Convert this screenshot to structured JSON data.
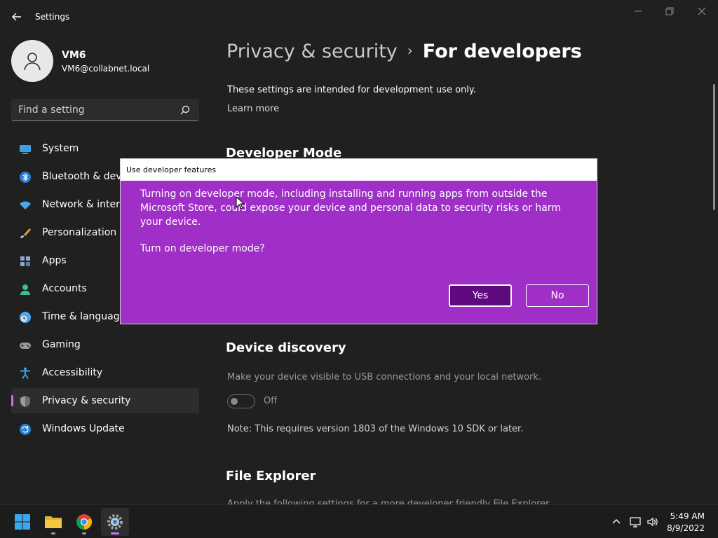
{
  "window": {
    "app_title": "Settings"
  },
  "user": {
    "name": "VM6",
    "email": "VM6@collabnet.local"
  },
  "search": {
    "placeholder": "Find a setting"
  },
  "sidebar": {
    "items": [
      {
        "label": "System",
        "icon": "system-icon"
      },
      {
        "label": "Bluetooth & devices",
        "icon": "bluetooth-icon"
      },
      {
        "label": "Network & internet",
        "icon": "wifi-icon"
      },
      {
        "label": "Personalization",
        "icon": "brush-icon"
      },
      {
        "label": "Apps",
        "icon": "apps-icon"
      },
      {
        "label": "Accounts",
        "icon": "accounts-icon"
      },
      {
        "label": "Time & language",
        "icon": "clock-globe-icon"
      },
      {
        "label": "Gaming",
        "icon": "gamepad-icon"
      },
      {
        "label": "Accessibility",
        "icon": "accessibility-icon"
      },
      {
        "label": "Privacy & security",
        "icon": "shield-icon",
        "selected": true
      },
      {
        "label": "Windows Update",
        "icon": "update-icon"
      }
    ]
  },
  "main": {
    "breadcrumb_parent": "Privacy & security",
    "breadcrumb_separator": "›",
    "breadcrumb_current": "For developers",
    "intro": "These settings are intended for development use only.",
    "learn_more": "Learn more",
    "developer_mode_heading": "Developer Mode",
    "device_discovery_heading": "Device discovery",
    "device_discovery_desc": "Make your device visible to USB connections and your local network.",
    "device_discovery_toggle": "Off",
    "device_discovery_note": "Note: This requires version 1803 of the Windows 10 SDK or later.",
    "file_explorer_heading": "File Explorer",
    "file_explorer_partial": "Apply the following settings for a more developer friendly File Explorer"
  },
  "dialog": {
    "title": "Use developer features",
    "message": "Turning on developer mode, including installing and running apps from outside the Microsoft Store, could expose your device and personal data to security risks or harm your device.",
    "question": "Turn on developer mode?",
    "yes_label": "Yes",
    "no_label": "No"
  },
  "taskbar": {
    "apps": [
      "start-icon",
      "file-explorer-icon",
      "chrome-icon",
      "settings-icon"
    ],
    "time": "5:49 AM",
    "date": "8/9/2022"
  },
  "colors": {
    "accent": "#c774e8",
    "dialog_bg": "#a02fc8",
    "yes_button_bg": "#5e0a7e"
  }
}
